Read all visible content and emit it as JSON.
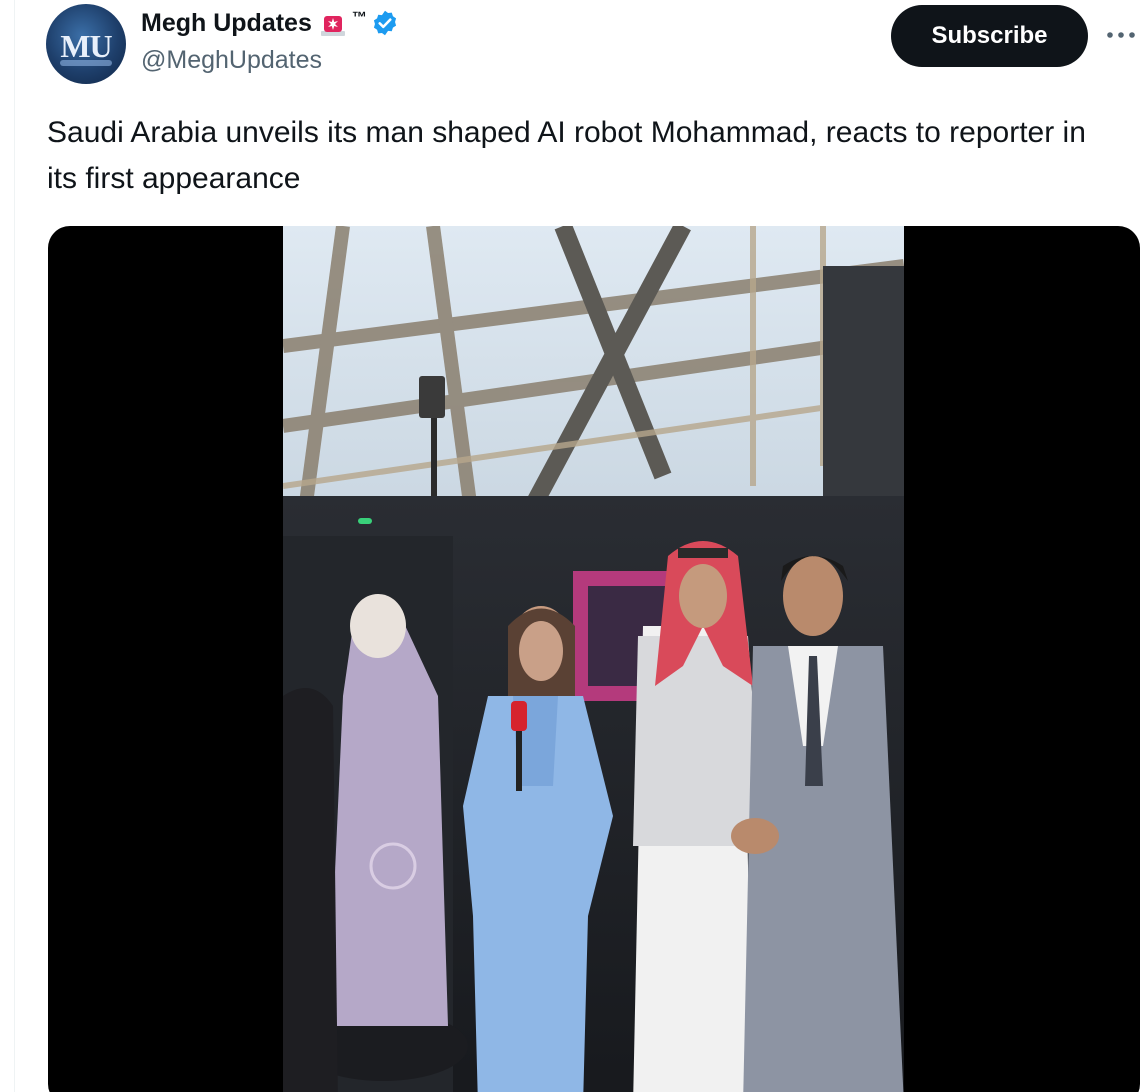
{
  "author": {
    "display_name": "Megh Updates",
    "tm": "™",
    "handle": "@MeghUpdates",
    "avatar_text": "MU",
    "badges": [
      "siren-icon",
      "verified-icon"
    ]
  },
  "actions": {
    "subscribe_label": "Subscribe",
    "more_icon": "more-icon"
  },
  "tweet": {
    "text": "Saudi Arabia unveils its man shaped AI robot Mohammad, reacts to reporter in its first appearance"
  },
  "colors": {
    "text_primary": "#0f1419",
    "text_secondary": "#536471",
    "verified_blue": "#1d9bf0",
    "subscribe_bg": "#0f1419",
    "siren_red": "#e0245e"
  }
}
